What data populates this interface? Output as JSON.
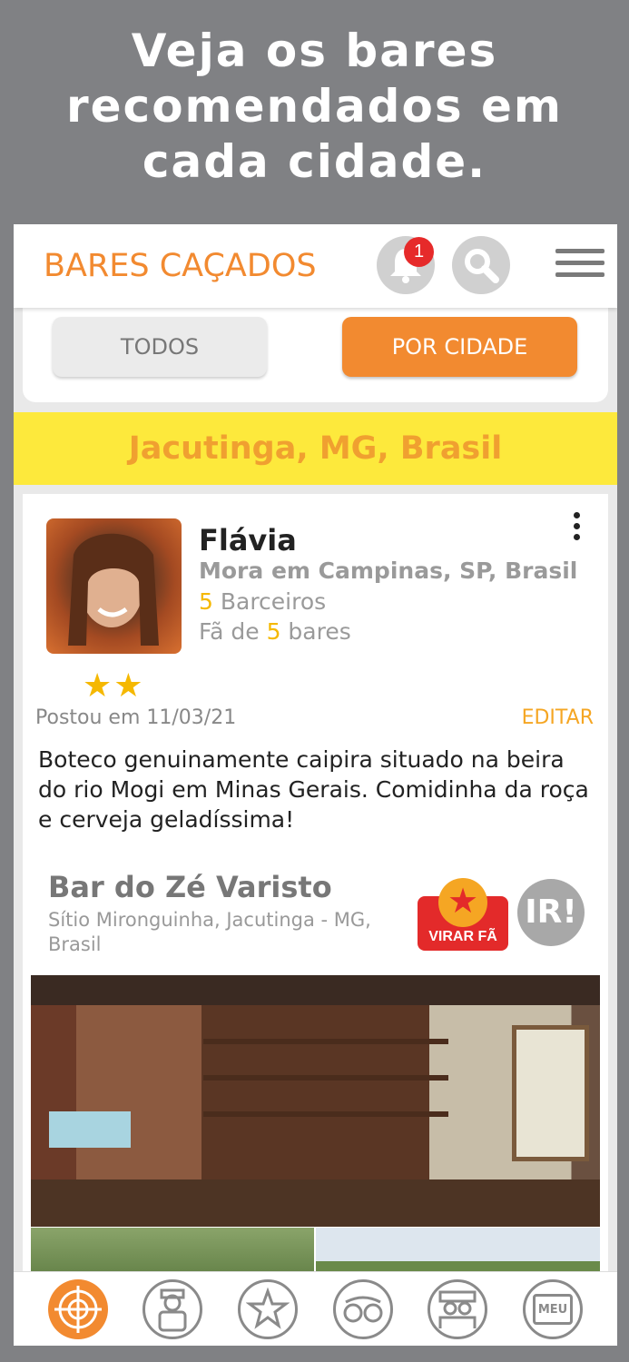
{
  "promo": {
    "line1": "Veja os bares",
    "line2": "recomendados em",
    "line3": "cada cidade."
  },
  "appbar": {
    "title": "BARES CAÇADOS",
    "notification_count": "1"
  },
  "filters": {
    "all_label": "TODOS",
    "by_city_label": "POR CIDADE"
  },
  "city": "Jacutinga, MG, Brasil",
  "post": {
    "user_name": "Flávia",
    "user_city": "Mora em Campinas, SP, Brasil",
    "friends_count": "5",
    "friends_label": " Barceiros",
    "fan_prefix": "Fã de ",
    "fan_count": "5",
    "fan_suffix": " bares",
    "stars": "★★",
    "posted": "Postou em 11/03/21",
    "edit_label": "EDITAR",
    "text": "Boteco genuinamente caipira situado na beira do rio Mogi em Minas Gerais. Comidinha da roça e cerveja geladíssima!",
    "bar_name": "Bar do Zé Varisto",
    "bar_address": "Sítio Mironguinha, Jacutinga - MG, Brasil",
    "fan_button_label": "VIRAR FÃ",
    "go_button_label": "IR!"
  },
  "tabbar": {
    "meu_label": "MEU"
  },
  "colors": {
    "accent": "#f28a30",
    "city_band": "#fde93c",
    "star": "#f5b800",
    "fan_red": "#e32a2a"
  }
}
